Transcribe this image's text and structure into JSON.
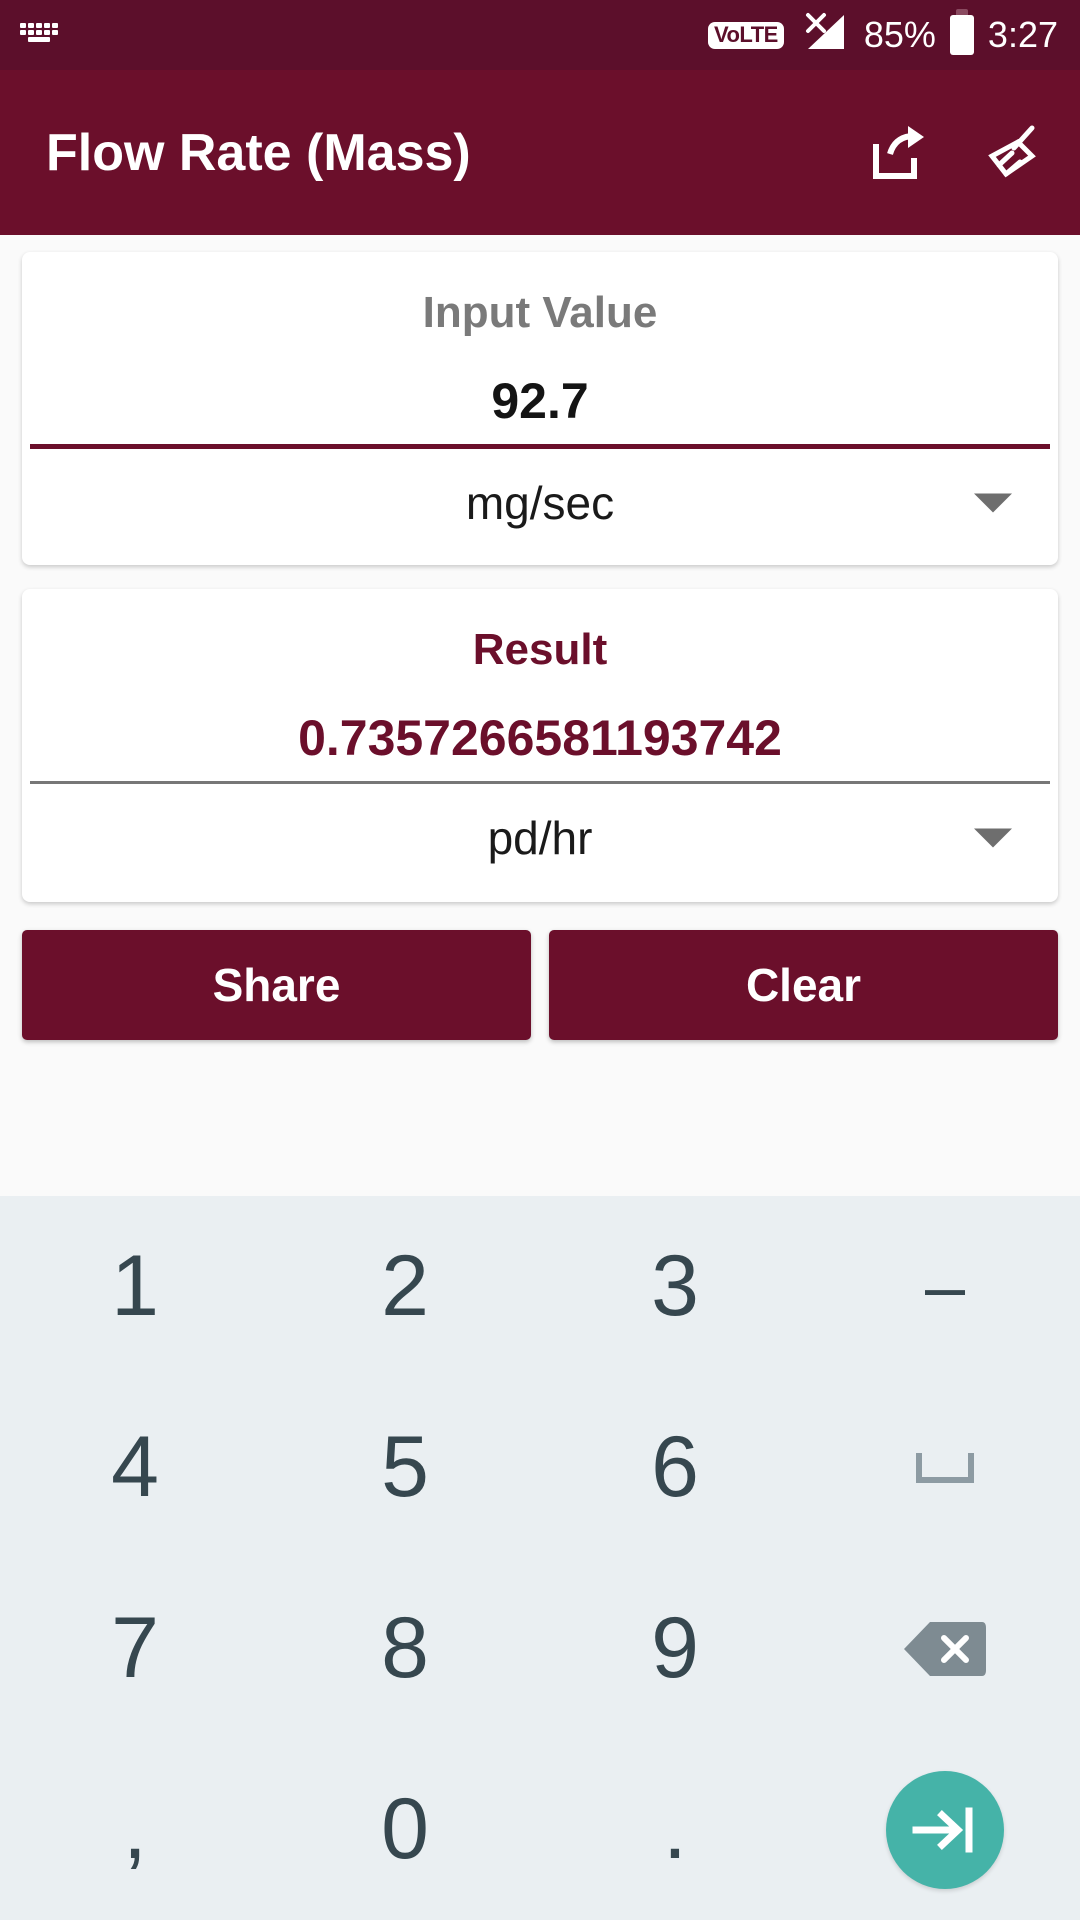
{
  "status_bar": {
    "keyboard_icon": "keyboard-icon",
    "volte_label": "VoLTE",
    "signal_icon": "signal-no-service-icon",
    "battery_percent": "85%",
    "battery_icon": "battery-icon",
    "time": "3:27"
  },
  "app_bar": {
    "title": "Flow Rate (Mass)",
    "share_icon": "share-icon",
    "clear_icon": "broom-icon",
    "background_color": "#6B0F2B"
  },
  "input_card": {
    "label": "Input Value",
    "value": "92.7",
    "unit": "mg/sec",
    "dropdown_icon": "chevron-down-icon",
    "underline_color": "#6B0F2B"
  },
  "result_card": {
    "label": "Result",
    "value": "0.7357266581193742",
    "unit": "pd/hr",
    "dropdown_icon": "chevron-down-icon",
    "underline_color": "#777777",
    "text_color": "#6B0F2B"
  },
  "actions": {
    "share_label": "Share",
    "clear_label": "Clear"
  },
  "keyboard": {
    "background_color": "#EAEFF2",
    "key_color": "#36474F",
    "accent_color": "#45B3A8",
    "rows": [
      [
        {
          "label": "1",
          "name": "key-1",
          "type": "digit"
        },
        {
          "label": "2",
          "name": "key-2",
          "type": "digit"
        },
        {
          "label": "3",
          "name": "key-3",
          "type": "digit"
        },
        {
          "label": "–",
          "name": "key-minus",
          "type": "digit"
        }
      ],
      [
        {
          "label": "4",
          "name": "key-4",
          "type": "digit"
        },
        {
          "label": "5",
          "name": "key-5",
          "type": "digit"
        },
        {
          "label": "6",
          "name": "key-6",
          "type": "digit"
        },
        {
          "label": "",
          "name": "key-space",
          "type": "space"
        }
      ],
      [
        {
          "label": "7",
          "name": "key-7",
          "type": "digit"
        },
        {
          "label": "8",
          "name": "key-8",
          "type": "digit"
        },
        {
          "label": "9",
          "name": "key-9",
          "type": "digit"
        },
        {
          "label": "",
          "name": "key-backspace",
          "type": "backspace"
        }
      ],
      [
        {
          "label": ",",
          "name": "key-comma",
          "type": "digit"
        },
        {
          "label": "0",
          "name": "key-0",
          "type": "digit"
        },
        {
          "label": ".",
          "name": "key-period",
          "type": "digit"
        },
        {
          "label": "",
          "name": "key-next",
          "type": "enter"
        }
      ]
    ]
  }
}
